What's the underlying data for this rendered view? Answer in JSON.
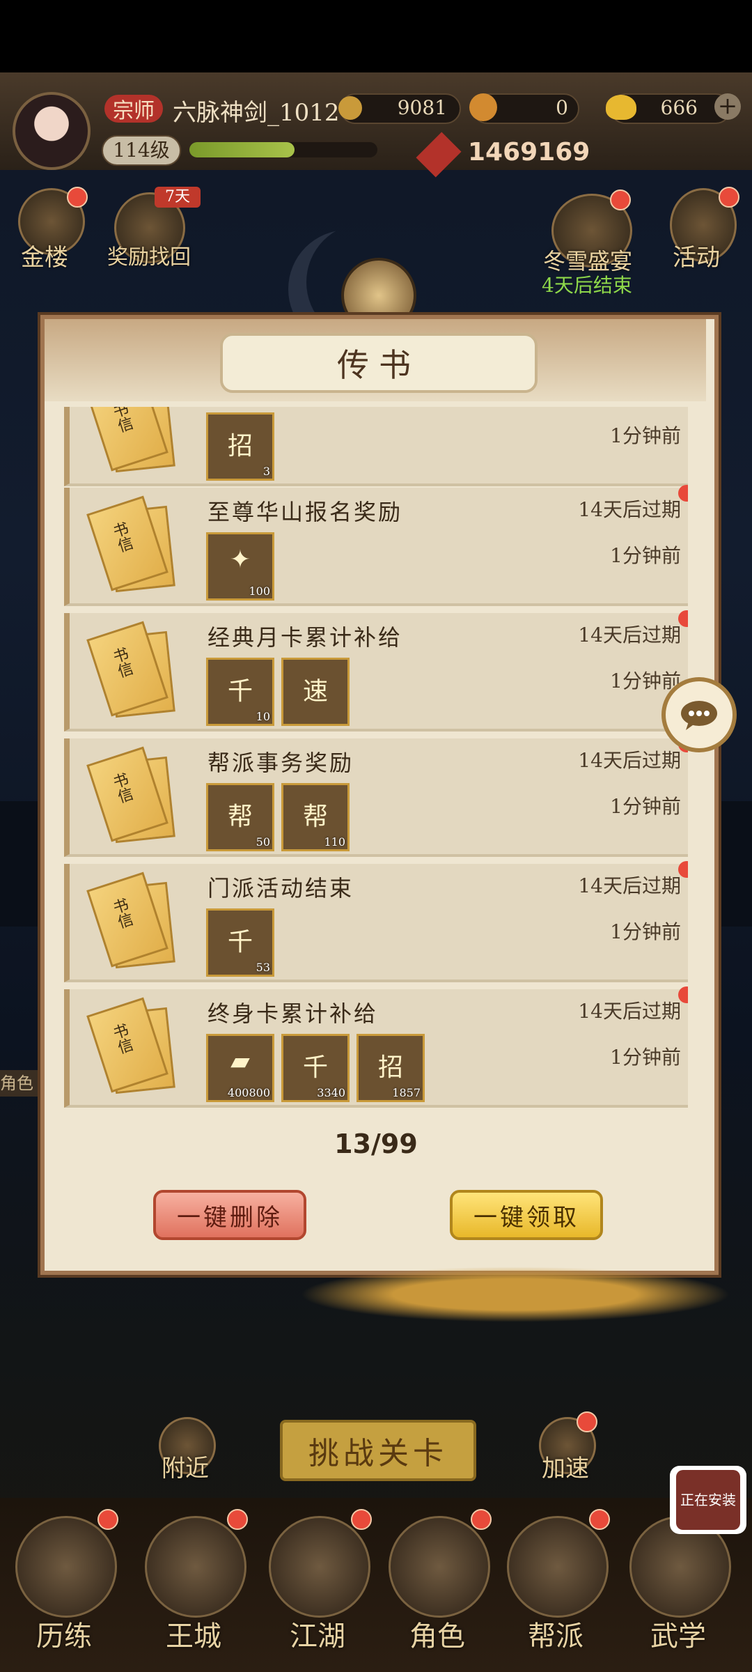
{
  "header": {
    "title_tag": "宗师",
    "player_name": "六脉神剑_1012",
    "coins": "9081",
    "energy": "0",
    "ingots": "666",
    "level": "114级",
    "power": "1469169"
  },
  "side_icons": {
    "gold_building": "金楼",
    "reward_recovery": "奖励找回",
    "reward_recovery_badge": "7天",
    "winter_feast": "冬雪盛宴",
    "winter_feast_note": "4天后结束",
    "activity": "活动",
    "role_tag": "角色"
  },
  "mail_panel": {
    "title": "传书",
    "counter": "13/99",
    "delete_all": "一键删除",
    "claim_all": "一键领取",
    "letter_glyph": "书信",
    "mails": [
      {
        "title": "",
        "expire": "",
        "time": "1分钟前",
        "items": [
          {
            "icon": "招",
            "count": "3"
          }
        ],
        "unread": false
      },
      {
        "title": "至尊华山报名奖励",
        "expire": "14天后过期",
        "time": "1分钟前",
        "items": [
          {
            "icon": "✦",
            "count": "100"
          }
        ],
        "unread": true
      },
      {
        "title": "经典月卡累计补给",
        "expire": "14天后过期",
        "time": "1分钟前",
        "items": [
          {
            "icon": "千",
            "count": "10"
          },
          {
            "icon": "速",
            "count": ""
          }
        ],
        "unread": true
      },
      {
        "title": "帮派事务奖励",
        "expire": "14天后过期",
        "time": "1分钟前",
        "items": [
          {
            "icon": "帮",
            "count": "50"
          },
          {
            "icon": "帮",
            "count": "110"
          }
        ],
        "unread": true
      },
      {
        "title": "门派活动结束",
        "expire": "14天后过期",
        "time": "1分钟前",
        "items": [
          {
            "icon": "千",
            "count": "53"
          }
        ],
        "unread": true
      },
      {
        "title": "终身卡累计补给",
        "expire": "14天后过期",
        "time": "1分钟前",
        "items": [
          {
            "icon": "▰",
            "count": "400800"
          },
          {
            "icon": "千",
            "count": "3340"
          },
          {
            "icon": "招",
            "count": "1857"
          }
        ],
        "unread": true
      }
    ]
  },
  "bottom_nav": {
    "nearby": "附近",
    "challenge": "挑战关卡",
    "speedup": "加速",
    "tabs": [
      "历练",
      "王城",
      "江湖",
      "角色",
      "帮派",
      "武学"
    ]
  },
  "installing": "正在安装",
  "colors": {
    "unread_dot": "#e8493a",
    "panel_bg": "#efe6d1",
    "claim_button": "#e8b82a",
    "delete_button": "#e0725e"
  }
}
